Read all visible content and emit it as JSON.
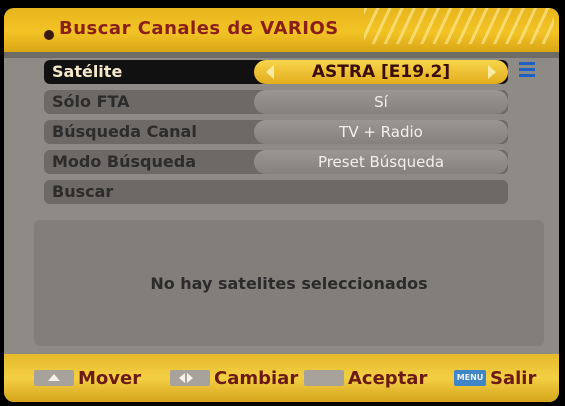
{
  "header": {
    "title": "Buscar Canales de VARIOS"
  },
  "rows": [
    {
      "label": "Satélite",
      "value": "ASTRA [E19.2]"
    },
    {
      "label": "Sólo FTA",
      "value": "Sí"
    },
    {
      "label": "Búsqueda Canal",
      "value": "TV + Radio"
    },
    {
      "label": "Modo Búsqueda",
      "value": "Preset Búsqueda"
    },
    {
      "label": "Buscar"
    }
  ],
  "message": "No hay satelites seleccionados",
  "footer": {
    "move": "Mover",
    "change": "Cambiar",
    "accept": "Aceptar",
    "menu_key": "MENU",
    "exit": "Salir"
  },
  "colors": {
    "header_bar": "#f2c325",
    "title_text": "#8a1f18",
    "active_value": "#f3c232",
    "footer_text": "#6b1b12",
    "scroll_icon": "#1f5fc4"
  }
}
